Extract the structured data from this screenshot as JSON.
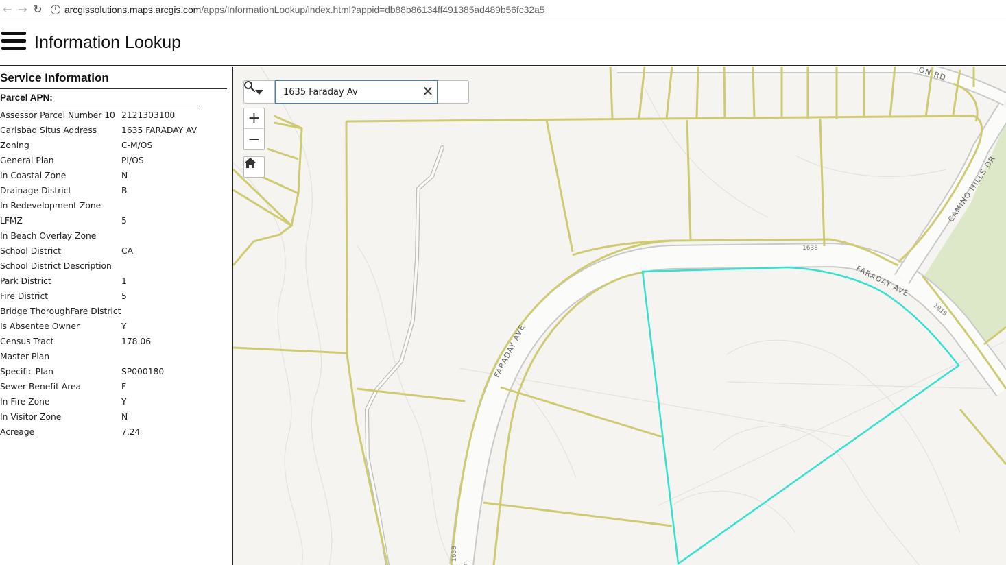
{
  "browser": {
    "url_host": "arcgissolutions.maps.arcgis.com",
    "url_path": "/apps/InformationLookup/index.html?appid=db88b86134ff491385ad489b56fc32a5"
  },
  "app": {
    "title": "Information Lookup"
  },
  "panel": {
    "title": "Service Information",
    "subtitle": "Parcel APN:",
    "rows": [
      {
        "label": "Assessor Parcel Number 10",
        "value": "2121303100"
      },
      {
        "label": "Carlsbad Situs Address",
        "value": "1635 FARADAY AV"
      },
      {
        "label": "Zoning",
        "value": "C-M/OS"
      },
      {
        "label": "General Plan",
        "value": "PI/OS"
      },
      {
        "label": "In Coastal Zone",
        "value": "N"
      },
      {
        "label": "Drainage District",
        "value": "B"
      },
      {
        "label": "In Redevelopment Zone",
        "value": ""
      },
      {
        "label": "LFMZ",
        "value": "5"
      },
      {
        "label": "In Beach Overlay Zone",
        "value": ""
      },
      {
        "label": "School District",
        "value": "CA"
      },
      {
        "label": "School District Description",
        "value": ""
      },
      {
        "label": "Park District",
        "value": "1"
      },
      {
        "label": "Fire District",
        "value": "5"
      },
      {
        "label": "Bridge ThoroughFare District",
        "value": ""
      },
      {
        "label": "Is Absentee Owner",
        "value": "Y"
      },
      {
        "label": "Census Tract",
        "value": "178.06"
      },
      {
        "label": "Master Plan",
        "value": ""
      },
      {
        "label": "Specific Plan",
        "value": "SP000180"
      },
      {
        "label": "Sewer Benefit Area",
        "value": "F"
      },
      {
        "label": "In Fire Zone",
        "value": "Y"
      },
      {
        "label": "In Visitor Zone",
        "value": "N"
      },
      {
        "label": "Acreage",
        "value": "7.24"
      }
    ]
  },
  "search": {
    "value": "1635 Faraday Av"
  },
  "map": {
    "labels": {
      "faraday_east": "FARADAY AVE",
      "faraday_west": "FARADAY AVE",
      "camino_hills": "CAMINO HILLS DR",
      "top_rd": "ON RD",
      "lot_1638_top": "1638",
      "lot_1815": "1815",
      "lot_1638_bottom": "1638",
      "bottom_e": "E"
    },
    "colors": {
      "parcel": "#cfcb73",
      "selected": "#35e0d0",
      "road": "#c8c8c8",
      "park": "#dde8c9"
    }
  }
}
